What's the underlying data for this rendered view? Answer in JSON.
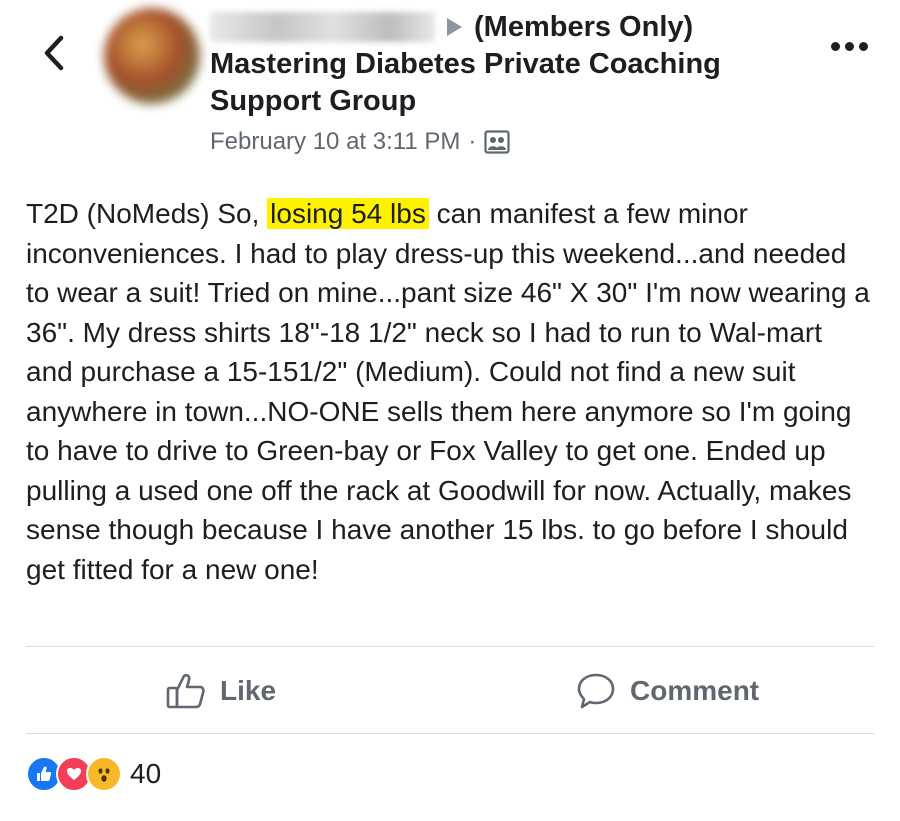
{
  "header": {
    "author_name_blurred": "",
    "group_privacy": "(Members Only)",
    "group_name": "Mastering Diabetes Private Coaching Support Group",
    "timestamp": "February 10 at 3:11 PM",
    "separator": "·",
    "audience_icon": "group-audience-icon"
  },
  "post": {
    "text_before": "T2D (NoMeds) So, ",
    "highlight": "losing 54 lbs",
    "text_after": " can manifest a few minor inconveniences. I had to play dress-up this weekend...and needed to wear a suit! Tried on mine...pant size 46\" X 30\" I'm now wearing a 36\". My dress shirts 18\"-18 1/2\" neck so I had to run to Wal-mart and purchase a 15-151/2\" (Medium). Could not find a new suit anywhere in town...NO-ONE sells them here anymore so I'm going to have to drive to Green-bay or Fox Valley to get one. Ended up pulling a used one off the rack at Goodwill for now. Actually,  makes sense though because I have another 15 lbs. to go before I should get fitted for a new one!",
    "highlight_color": "#fff200"
  },
  "actions": {
    "like_label": "Like",
    "comment_label": "Comment"
  },
  "reactions": {
    "types": [
      "like",
      "love",
      "wow"
    ],
    "count": "40"
  },
  "colors": {
    "like_blue": "#1877f2",
    "love_red": "#f33e58",
    "wow_yellow": "#f7b928",
    "muted_text": "#606770"
  }
}
